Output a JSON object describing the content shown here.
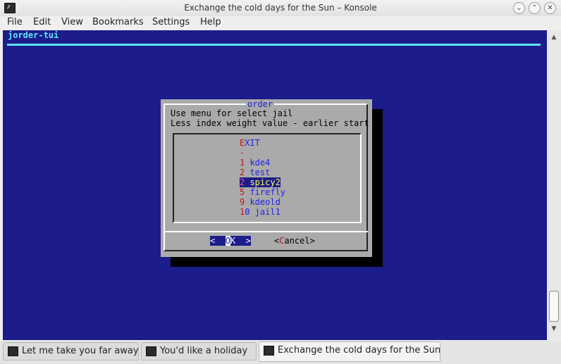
{
  "window": {
    "title": "Exchange the cold days for the Sun – Konsole",
    "buttons": {
      "minimize": "⌄",
      "maximize": "⌃",
      "close": "✕"
    }
  },
  "menu": [
    "File",
    "Edit",
    "View",
    "Bookmarks",
    "Settings",
    "Help"
  ],
  "terminal": {
    "header": "jorder-tui",
    "dialog": {
      "title": "order",
      "line1": "Use menu for select jail",
      "line2": "Less index weight value - earlier start",
      "items": [
        {
          "index": "E",
          "label": "XIT"
        },
        {
          "index": "-",
          "label": ""
        },
        {
          "index": "1",
          "label": " kde4"
        },
        {
          "index": "2",
          "label": " test"
        },
        {
          "index": "2",
          "label": " spicy2"
        },
        {
          "index": "5",
          "label": " firefly"
        },
        {
          "index": "9",
          "label": " kdeold"
        },
        {
          "index": "1",
          "label": "0 jail1"
        }
      ],
      "ok": {
        "pre": "<  ",
        "hotkey": "O",
        "post": "K  >"
      },
      "cancel": {
        "pre": "<",
        "hotkey": "C",
        "post": "ancel>"
      }
    }
  },
  "tabs": [
    {
      "label": "Let me take you far away"
    },
    {
      "label": "You'd like a holiday"
    },
    {
      "label": "Exchange the cold days for the Sun"
    }
  ],
  "colors": {
    "terminal_bg": "#1c1c8c",
    "accent": "#5de8f6",
    "dialog_bg": "#aaaaaa"
  }
}
